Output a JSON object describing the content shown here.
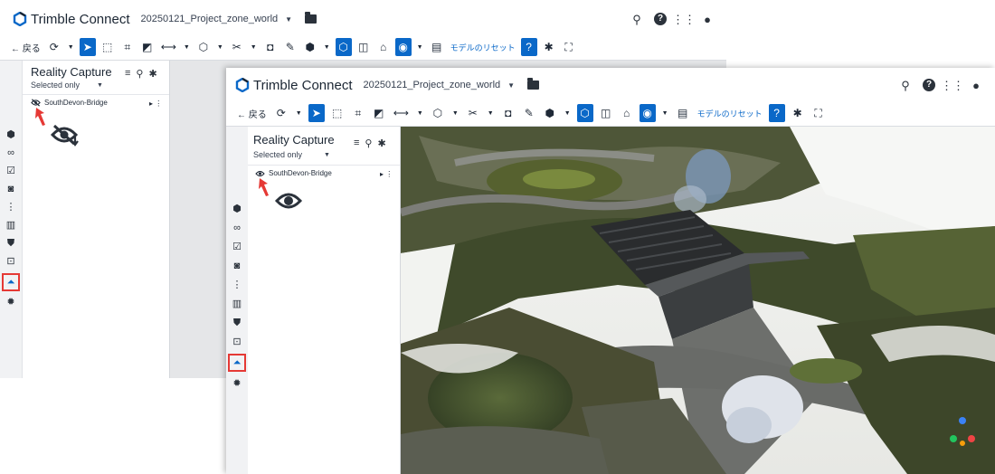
{
  "brand": "Trimble Connect",
  "project": "20250121_Project_zone_world",
  "toolbar": {
    "back_label": "← 戻る",
    "reset_label": "モデルのリセット"
  },
  "panel": {
    "title": "Reality Capture",
    "filter": "Selected only",
    "item": "SouthDevon-Bridge"
  },
  "annotations": {
    "hidden_state_icon": "eye-slash-download-icon",
    "visible_state_icon": "eye-icon"
  },
  "colors": {
    "accent": "#0a68c8",
    "highlight": "#e53935"
  },
  "left_rail_icons": [
    "cube-icon",
    "link-icon",
    "checkbox-icon",
    "camera-icon",
    "tree-icon",
    "table-icon",
    "shield-icon",
    "scan-icon",
    "reality-capture-icon",
    "gear-icon"
  ]
}
